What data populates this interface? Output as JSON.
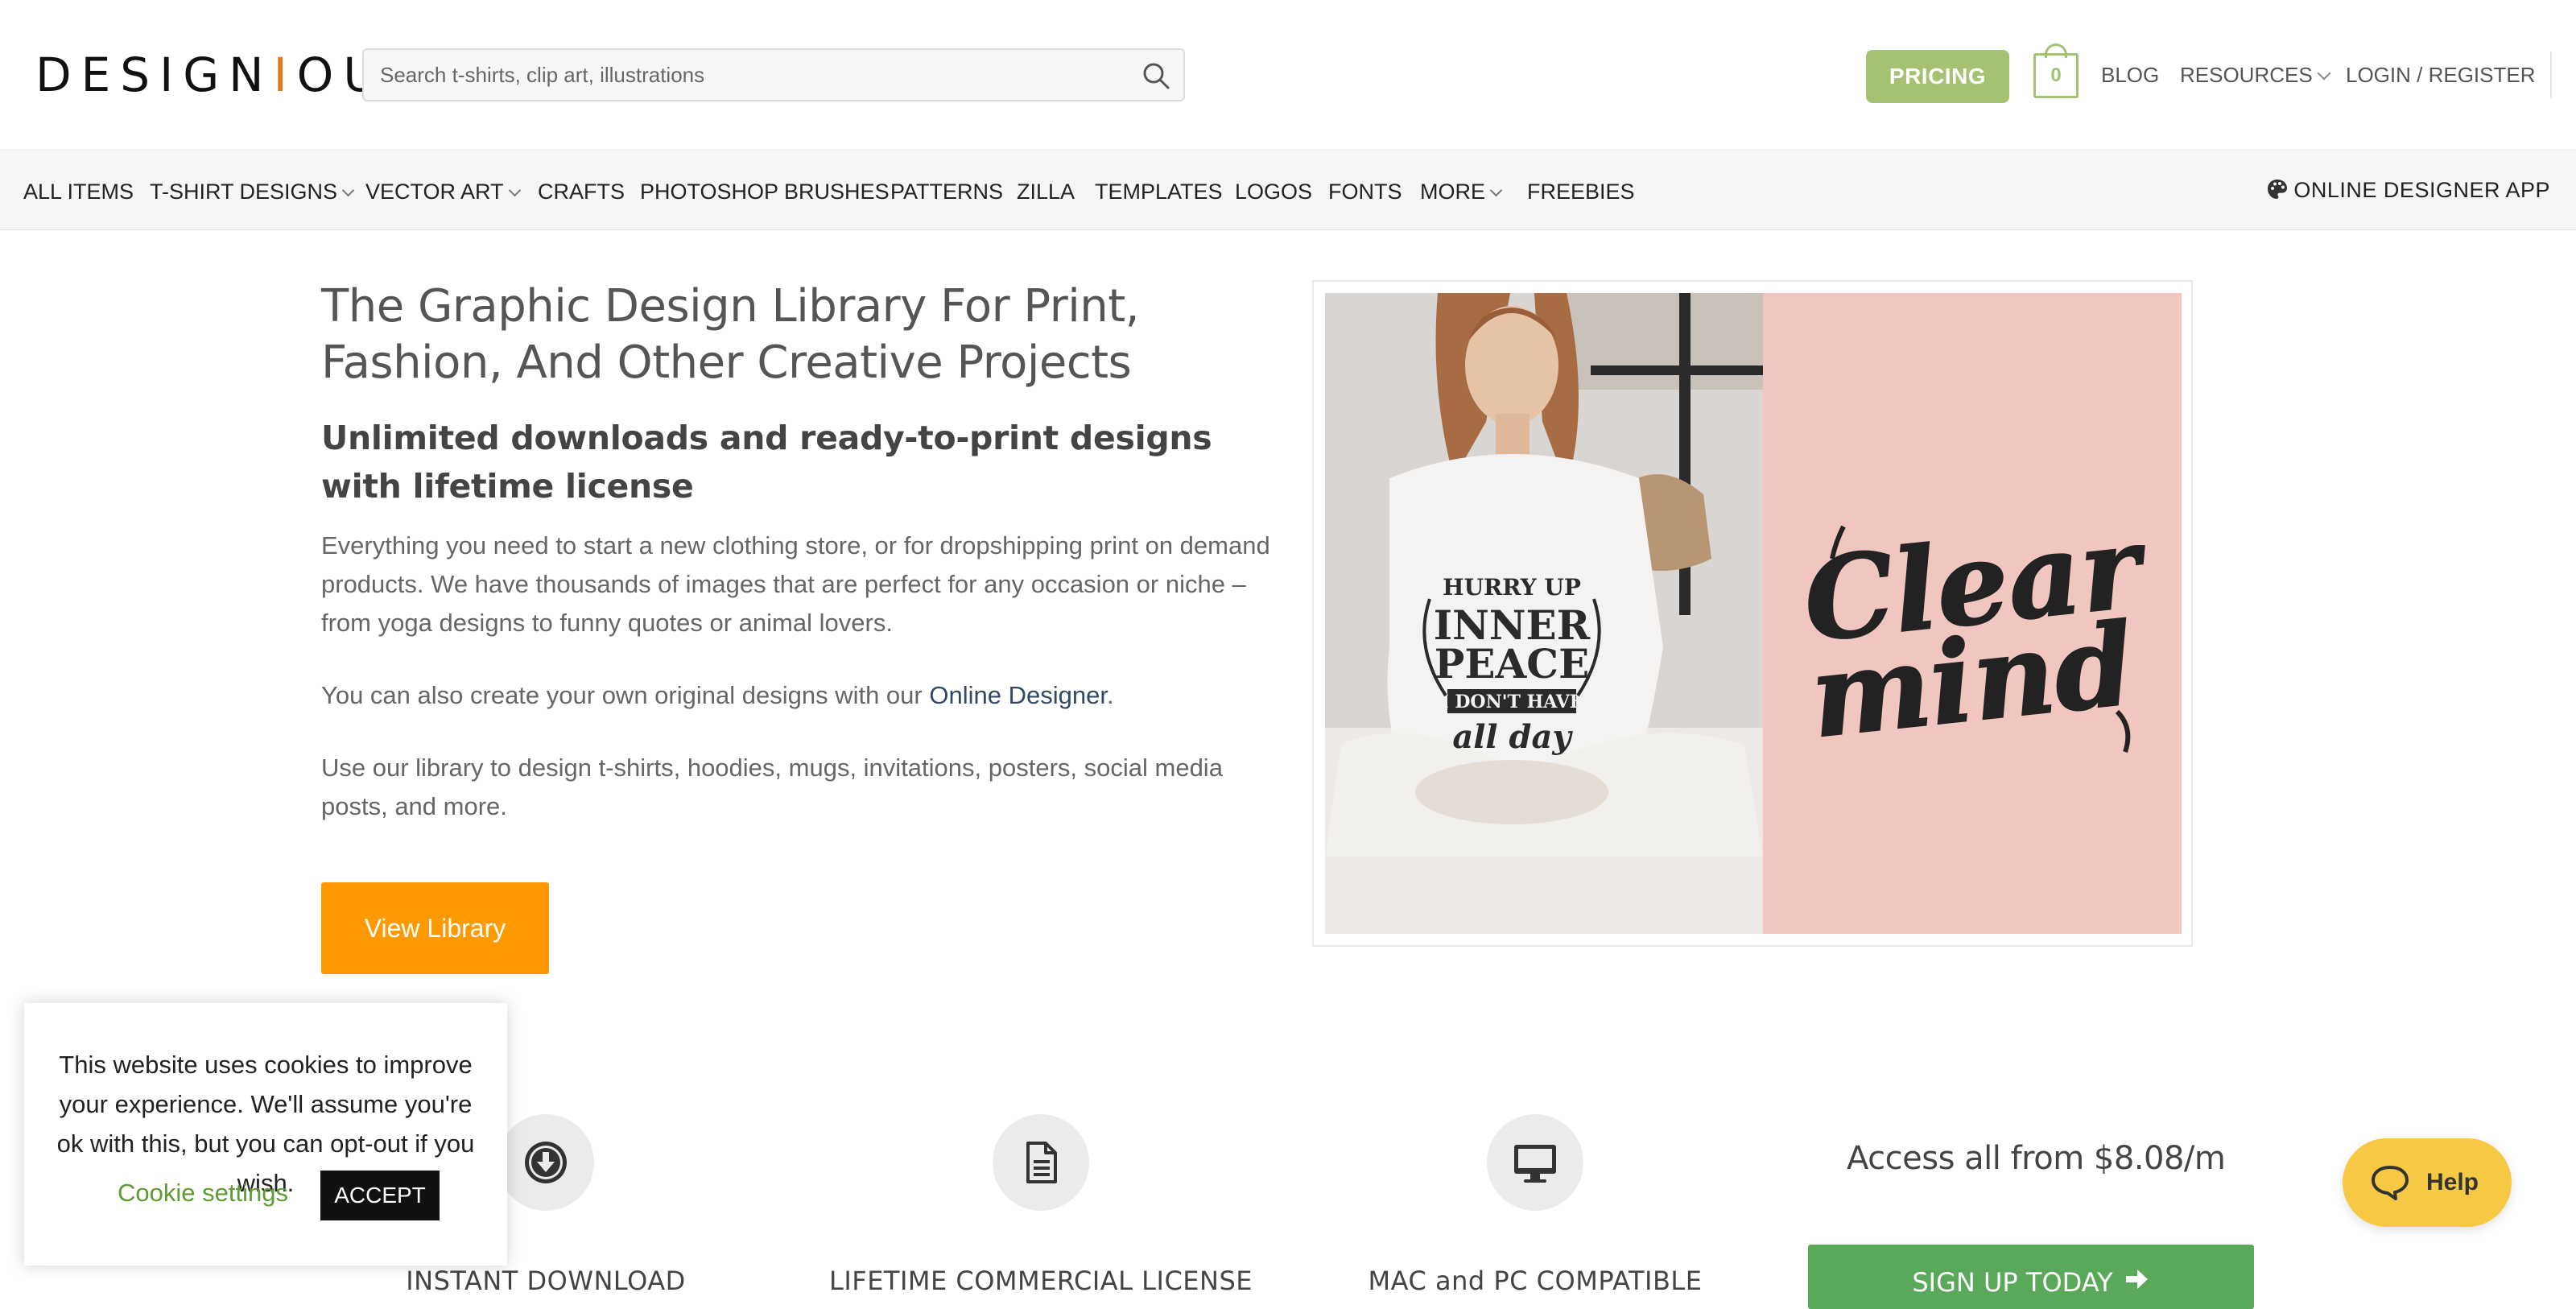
{
  "header": {
    "logo": {
      "pre": "DESIGN",
      "dot": "I",
      "post": "OUS"
    },
    "search_placeholder": "Search t-shirts, clip art, illustrations",
    "pricing_label": "PRICING",
    "cart_count": "0",
    "blog_label": "BLOG",
    "resources_label": "RESOURCES",
    "login_label": "LOGIN / REGISTER"
  },
  "nav": {
    "items": [
      "ALL ITEMS",
      "T-SHIRT DESIGNS",
      "VECTOR ART",
      "CRAFTS",
      "PHOTOSHOP BRUSHES",
      "PATTERNS",
      "ZILLA",
      "TEMPLATES",
      "LOGOS",
      "FONTS",
      "MORE",
      "FREEBIES"
    ],
    "app_label": "ONLINE DESIGNER APP"
  },
  "hero": {
    "title": "The Graphic Design Library For Print, Fashion, And Other Creative Projects",
    "subtitle": "Unlimited downloads and ready-to-print designs with lifetime license",
    "p1": "Everything you need to start a new clothing store, or for dropshipping print on demand products. We have thousands of images that are perfect for any occasion or niche – from yoga designs to funny quotes or animal lovers.",
    "p2_before": "You can also create your own original designs with our ",
    "p2_link": "Online Designer",
    "p2_after": ".",
    "p3": "Use our library to design t-shirts, hoodies, mugs, invitations, posters, social media posts, and more.",
    "cta": "View Library",
    "image": {
      "shirt_lines": [
        "HURRY UP",
        "INNER",
        "PEACE",
        "I DON'T HAVE",
        "all day"
      ],
      "art_lines": [
        "Clear",
        "mind"
      ]
    }
  },
  "features": {
    "items": [
      {
        "label": "INSTANT DOWNLOAD",
        "icon": "download-icon"
      },
      {
        "label": "LIFETIME COMMERCIAL LICENSE",
        "icon": "document-icon"
      },
      {
        "label": "MAC and PC COMPATIBLE",
        "icon": "monitor-icon"
      }
    ],
    "access_text": "Access all from $8.08/m",
    "signup_label": "SIGN UP TODAY"
  },
  "cookie": {
    "message": "This website uses cookies to improve your experience. We'll assume you're ok with this, but you can opt-out if you wish.",
    "settings_label": "Cookie settings",
    "accept_label": "ACCEPT"
  },
  "help": {
    "label": "Help"
  },
  "colors": {
    "pricing": "#a5c273",
    "cta_orange": "#ff9900",
    "signup_green": "#5aa95b",
    "help_yellow": "#f7c843",
    "link_navy": "#334862",
    "cookie_settings_green": "#5f9b34"
  }
}
